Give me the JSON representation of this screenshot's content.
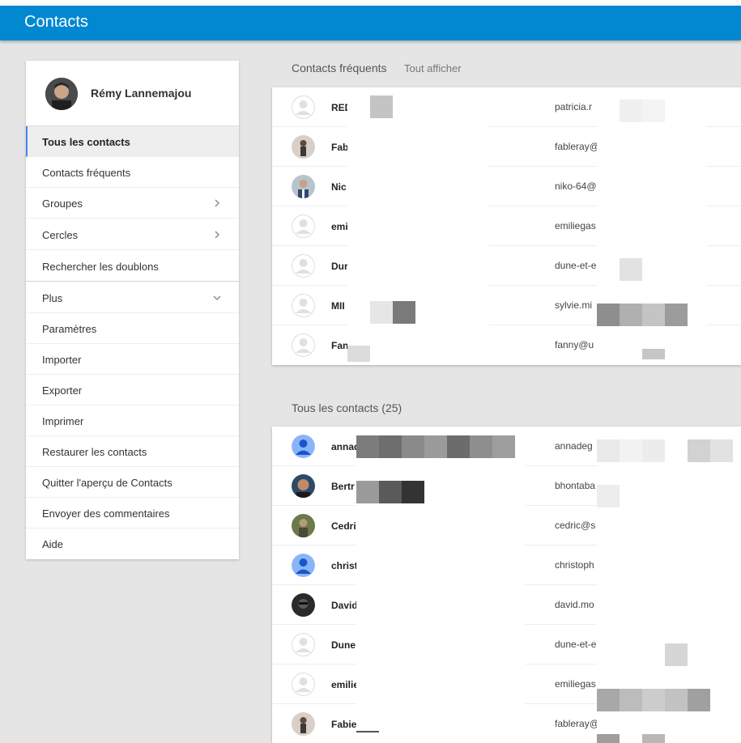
{
  "app": {
    "title": "Contacts"
  },
  "profile": {
    "name": "Rémy Lannemajou"
  },
  "nav": {
    "items": [
      {
        "label": "Tous les contacts",
        "active": true
      },
      {
        "label": "Contacts fréquents"
      },
      {
        "label": "Groupes",
        "chevron": "chevron-right-icon"
      },
      {
        "label": "Cercles",
        "chevron": "chevron-right-icon"
      },
      {
        "label": "Rechercher les doublons"
      },
      {
        "label": "Plus",
        "chevron": "chevron-down-icon"
      },
      {
        "label": "Paramètres"
      },
      {
        "label": "Importer"
      },
      {
        "label": "Exporter"
      },
      {
        "label": "Imprimer"
      },
      {
        "label": "Restaurer les contacts"
      },
      {
        "label": "Quitter l'aperçu de Contacts"
      },
      {
        "label": "Envoyer des commentaires"
      },
      {
        "label": "Aide"
      }
    ]
  },
  "frequent": {
    "heading": "Contacts fréquents",
    "show_all": "Tout afficher",
    "rows": [
      {
        "name": "RED",
        "email": "patricia.r",
        "avatar": "default"
      },
      {
        "name": "Fab",
        "email": "fableray@",
        "avatar": "photo"
      },
      {
        "name": "Nic",
        "email": "niko-64@",
        "avatar": "photo"
      },
      {
        "name": "emi",
        "email": "emiliegas",
        "avatar": "default"
      },
      {
        "name": "Dur",
        "email": "dune-et-e",
        "avatar": "default"
      },
      {
        "name": "MII",
        "email": "sylvie.mi",
        "avatar": "default"
      },
      {
        "name": "Fan",
        "email": "fanny@u",
        "avatar": "default"
      }
    ]
  },
  "all": {
    "heading": "Tous les contacts (25)",
    "rows": [
      {
        "name": "annad",
        "email": "annadeg",
        "avatar": "blue"
      },
      {
        "name": "Bertr",
        "email": "bhontaba",
        "avatar": "photo"
      },
      {
        "name": "Cedri",
        "email": "cedric@s",
        "avatar": "photo"
      },
      {
        "name": "christ",
        "email": "christoph",
        "avatar": "blue"
      },
      {
        "name": "David",
        "email": "david.mo",
        "avatar": "photo"
      },
      {
        "name": "Dune",
        "email": "dune-et-e",
        "avatar": "default"
      },
      {
        "name": "emilie",
        "email": "emiliegas",
        "avatar": "default"
      },
      {
        "name": "Fabie",
        "email": "fableray@",
        "avatar": "photo"
      }
    ]
  },
  "colors": {
    "appbar": "#0288d1",
    "active_accent": "#4285f4",
    "avatar_blue": "#8ab4f8"
  }
}
